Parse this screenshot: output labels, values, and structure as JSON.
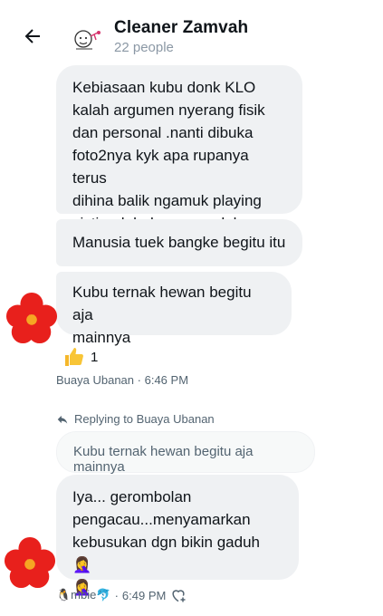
{
  "header": {
    "group_name": "Cleaner Zamvah",
    "member_count": "22 people"
  },
  "messages": [
    {
      "text": "Kebiasaan kubu donk KLO\nkalah argumen nyerang fisik\ndan personal .nanti dibuka\nfoto2nya kyk apa rupanya terus\ndihina balik ngamuk playing\nvictim dahal sana yg duluan"
    },
    {
      "text": "Manusia tuek bangke begitu itu"
    },
    {
      "text": "Kubu ternak hewan begitu aja\nmainnya"
    },
    {
      "text": "Iya... gerombolan\npengacau...menyamarkan\nkebusukan dgn bikin gaduh 🤦‍♀️\n🤦‍♀️"
    }
  ],
  "reaction": {
    "emoji": "thumbs-up",
    "count": "1"
  },
  "meta1": {
    "sender": "Buaya Ubanan",
    "sep": "·",
    "time": "6:46 PM"
  },
  "reply": {
    "label": "Replying to Buaya Ubanan",
    "quoted_text": "Kubu ternak hewan begitu aja mainnya"
  },
  "meta2": {
    "sender": "🐧mbie🐬",
    "sep": "·",
    "time": "6:49 PM"
  },
  "colors": {
    "bubble": "#eff1f3",
    "meta": "#536471",
    "flower_red": "#e8201c",
    "flower_center": "#f6a623"
  }
}
